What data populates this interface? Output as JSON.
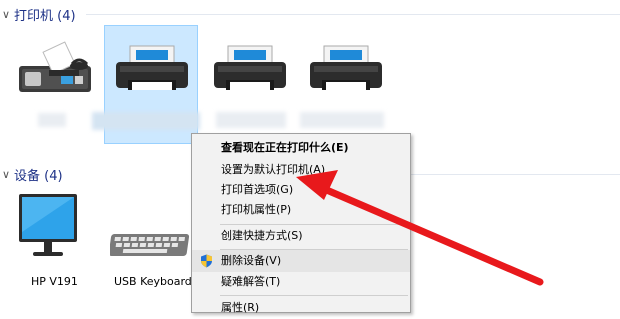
{
  "groups": {
    "printers": {
      "title": "打印机 (4)"
    },
    "devices": {
      "title": "设备 (4)"
    }
  },
  "devices": [
    {
      "label": "HP V191",
      "icon": "monitor-icon"
    },
    {
      "label": "USB Keyboard",
      "icon": "keyboard-icon"
    }
  ],
  "context_menu": {
    "items": [
      {
        "label": "查看现在正在打印什么(E)",
        "bold": true
      },
      {
        "label": "设置为默认打印机(A)"
      },
      {
        "label": "打印首选项(G)"
      },
      {
        "label": "打印机属性(P)"
      },
      {
        "label": "创建快捷方式(S)"
      },
      {
        "label": "删除设备(V)",
        "icon": "uac-shield-icon"
      },
      {
        "label": "疑难解答(T)"
      },
      {
        "label": "属性(R)"
      }
    ]
  },
  "colors": {
    "header_text": "#1e3287",
    "selection_bg": "#cce8ff",
    "arrow": "#e8191c"
  }
}
